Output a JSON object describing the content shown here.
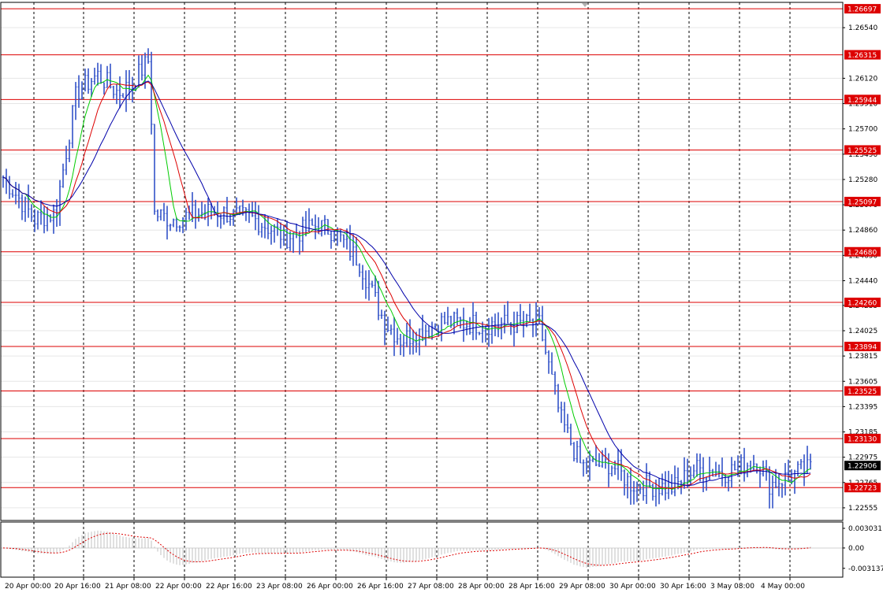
{
  "chart_data": [
    {
      "type": "candlestick",
      "ylim": [
        1.2245,
        1.2675
      ],
      "y_ticks": [
        {
          "label": "1.26540",
          "value": 1.2654
        },
        {
          "label": "1.26120",
          "value": 1.2612
        },
        {
          "label": "1.25910",
          "value": 1.2591
        },
        {
          "label": "1.25700",
          "value": 1.257
        },
        {
          "label": "1.25490",
          "value": 1.2549
        },
        {
          "label": "1.25280",
          "value": 1.2528
        },
        {
          "label": "1.25070",
          "value": 1.2507
        },
        {
          "label": "1.24860",
          "value": 1.2486
        },
        {
          "label": "1.24650",
          "value": 1.2465
        },
        {
          "label": "1.24440",
          "value": 1.2444
        },
        {
          "label": "1.24235",
          "value": 1.24235
        },
        {
          "label": "1.24025",
          "value": 1.24025
        },
        {
          "label": "1.23815",
          "value": 1.23815
        },
        {
          "label": "1.23605",
          "value": 1.23605
        },
        {
          "label": "1.23395",
          "value": 1.23395
        },
        {
          "label": "1.23185",
          "value": 1.23185
        },
        {
          "label": "1.22975",
          "value": 1.22975
        },
        {
          "label": "1.22765",
          "value": 1.22765
        },
        {
          "label": "1.22555",
          "value": 1.22555
        }
      ],
      "levels": [
        {
          "label": "1.26697",
          "value": 1.26697
        },
        {
          "label": "1.26315",
          "value": 1.26315
        },
        {
          "label": "1.25944",
          "value": 1.25944
        },
        {
          "label": "1.25525",
          "value": 1.25525
        },
        {
          "label": "1.25097",
          "value": 1.25097
        },
        {
          "label": "1.24680",
          "value": 1.2468
        },
        {
          "label": "1.24260",
          "value": 1.2426
        },
        {
          "label": "1.23894",
          "value": 1.23894
        },
        {
          "label": "1.23525",
          "value": 1.23525
        },
        {
          "label": "1.23130",
          "value": 1.2313
        },
        {
          "label": "1.22723",
          "value": 1.22723
        }
      ],
      "current_price": {
        "label": "1.22906",
        "value": 1.22906
      },
      "x_ticks": [
        "20 Apr 00:00",
        "20 Apr 16:00",
        "21 Apr 08:00",
        "22 Apr 00:00",
        "22 Apr 16:00",
        "23 Apr 08:00",
        "26 Apr 00:00",
        "26 Apr 16:00",
        "27 Apr 08:00",
        "28 Apr 00:00",
        "28 Apr 16:00",
        "29 Apr 08:00",
        "30 Apr 00:00",
        "30 Apr 16:00",
        "3 May 08:00",
        "4 May 00:00"
      ],
      "bar_count": 260,
      "price_anchors": [
        [
          0,
          1.253
        ],
        [
          15,
          1.2495
        ],
        [
          25,
          1.25
        ],
        [
          35,
          1.26
        ],
        [
          45,
          1.2615
        ],
        [
          55,
          1.26
        ],
        [
          60,
          1.2605
        ],
        [
          70,
          1.2628
        ],
        [
          72,
          1.25
        ],
        [
          80,
          1.2495
        ],
        [
          100,
          1.2502
        ],
        [
          120,
          1.2495
        ],
        [
          135,
          1.248
        ],
        [
          150,
          1.249
        ],
        [
          158,
          1.2485
        ],
        [
          170,
          1.246
        ],
        [
          182,
          1.241
        ],
        [
          190,
          1.2395
        ],
        [
          210,
          1.241
        ],
        [
          228,
          1.2408
        ],
        [
          256,
          1.2408
        ],
        [
          266,
          1.233
        ],
        [
          276,
          1.229
        ],
        [
          290,
          1.2292
        ],
        [
          300,
          1.2275
        ],
        [
          320,
          1.2272
        ],
        [
          330,
          1.2288
        ],
        [
          345,
          1.2285
        ],
        [
          360,
          1.2295
        ],
        [
          366,
          1.2275
        ],
        [
          380,
          1.2285
        ],
        [
          390,
          1.2291
        ]
      ],
      "ma_periods": [
        8,
        13,
        21
      ],
      "ma_colors": [
        "#00cc00",
        "#dd0000",
        "#0000aa"
      ],
      "bar_color": "#3353c8",
      "level_color": "#dd0000",
      "oscillator": {
        "ylim": [
          -0.0045,
          0.004
        ],
        "y_ticks": [
          {
            "label": "0.003031",
            "value": 0.003031
          },
          {
            "label": "0.00",
            "value": 0.0
          },
          {
            "label": "-0.003137",
            "value": -0.003137
          }
        ],
        "histogram_color": "#c0c0c0",
        "signal_color": "#dd0000"
      }
    }
  ]
}
